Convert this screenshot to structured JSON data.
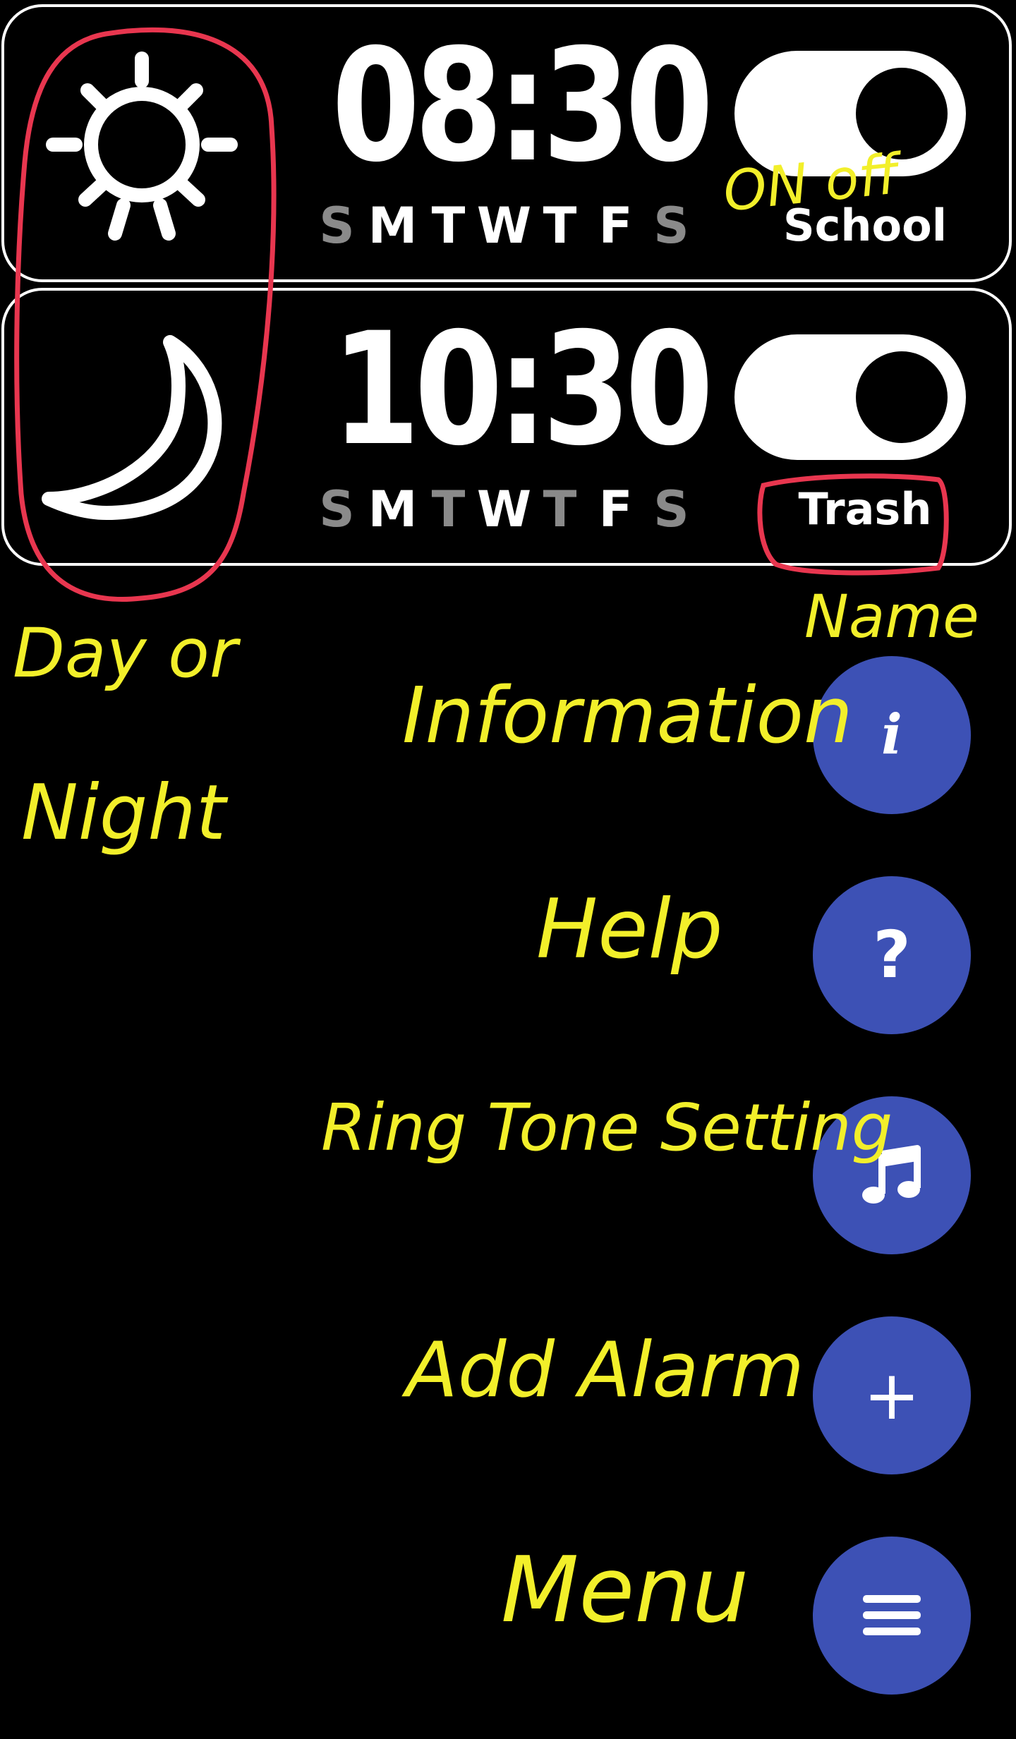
{
  "alarms": [
    {
      "time": "08:30",
      "mode": "sun-icon",
      "days": [
        {
          "letter": "S",
          "active": false
        },
        {
          "letter": "M",
          "active": true
        },
        {
          "letter": "T",
          "active": true
        },
        {
          "letter": "W",
          "active": true
        },
        {
          "letter": "T",
          "active": true
        },
        {
          "letter": "F",
          "active": true
        },
        {
          "letter": "S",
          "active": false
        }
      ],
      "enabled": false,
      "name": "School"
    },
    {
      "time": "10:30",
      "mode": "moon-icon",
      "days": [
        {
          "letter": "S",
          "active": false
        },
        {
          "letter": "M",
          "active": true
        },
        {
          "letter": "T",
          "active": false
        },
        {
          "letter": "W",
          "active": true
        },
        {
          "letter": "T",
          "active": false
        },
        {
          "letter": "F",
          "active": true
        },
        {
          "letter": "S",
          "active": false
        }
      ],
      "enabled": false,
      "name": "Trash"
    }
  ],
  "fabs": {
    "info": {
      "icon": "info-icon",
      "glyph": "i"
    },
    "help": {
      "icon": "help-icon",
      "glyph": "?"
    },
    "ringtone": {
      "icon": "music-note-icon"
    },
    "add": {
      "icon": "plus-icon",
      "glyph": "+"
    },
    "menu": {
      "icon": "hamburger-menu-icon"
    }
  },
  "annotations": {
    "on_off": "ON off",
    "name": "Name",
    "day_or_night_line1": "Day or",
    "day_or_night_line2": "Night",
    "information": "Information",
    "help": "Help",
    "ring_tone_setting": "Ring Tone Setting",
    "add_alarm": "Add Alarm",
    "menu": "Menu"
  },
  "colors": {
    "background": "#000000",
    "card_border": "#ffffff",
    "fab": "#3d51b5",
    "inactive_day": "#8a8a8a",
    "annotation_yellow": "#f2ef2a",
    "annotation_red": "#e8364f"
  }
}
